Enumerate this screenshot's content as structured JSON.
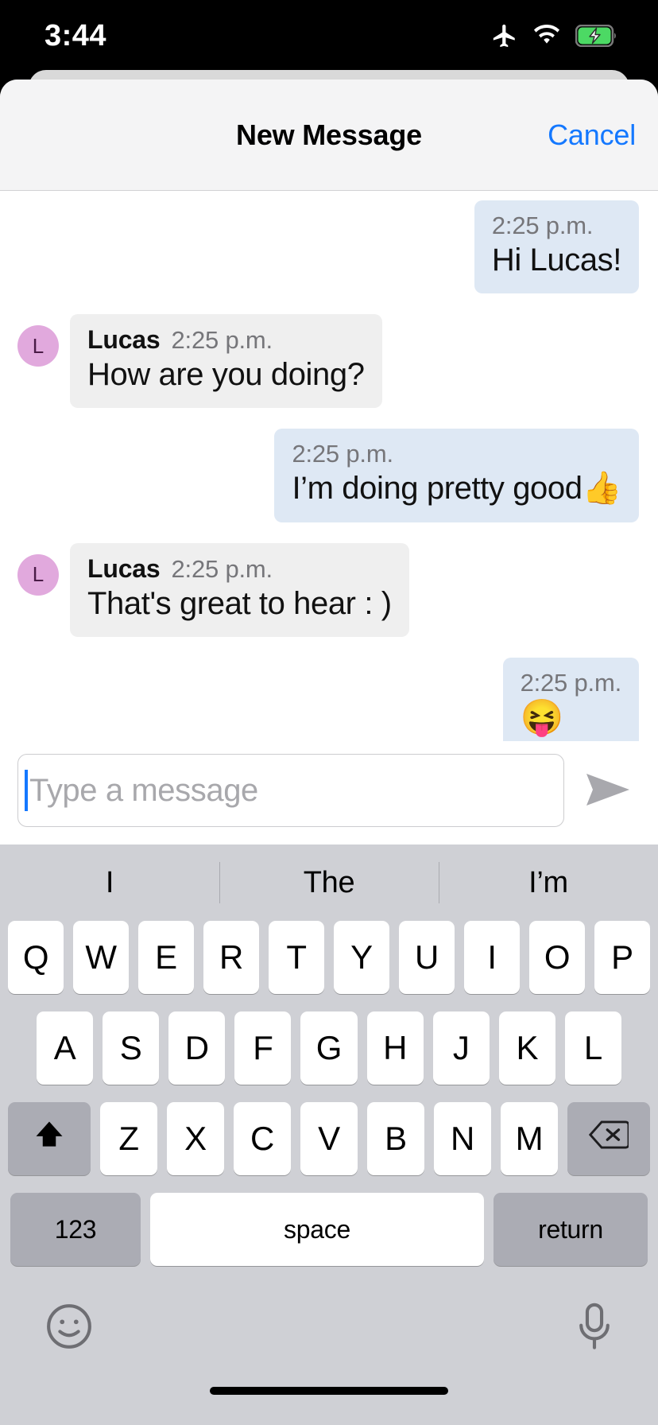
{
  "status_bar": {
    "time": "3:44",
    "icons": [
      "airplane-mode-icon",
      "wifi-icon",
      "battery-charging-icon"
    ],
    "battery_color": "#4cd964"
  },
  "sheet": {
    "title": "New Message",
    "cancel_label": "Cancel",
    "header_bg": "#f4f4f5",
    "accent_color": "#1478ff"
  },
  "conversation": {
    "messages": [
      {
        "direction": "outgoing",
        "sender": "",
        "time": "2:25 p.m.",
        "text": "Hi Lucas!",
        "emoji_only": false
      },
      {
        "direction": "incoming",
        "sender": "Lucas",
        "avatar_initial": "L",
        "time": "2:25 p.m.",
        "text": "How are you doing?",
        "emoji_only": false
      },
      {
        "direction": "outgoing",
        "sender": "",
        "time": "2:25 p.m.",
        "text": "I’m doing pretty good👍",
        "emoji_only": false
      },
      {
        "direction": "incoming",
        "sender": "Lucas",
        "avatar_initial": "L",
        "time": "2:25 p.m.",
        "text": "That's great to hear : )",
        "emoji_only": false
      },
      {
        "direction": "outgoing",
        "sender": "",
        "time": "2:25 p.m.",
        "text": "😝",
        "emoji_only": true
      }
    ],
    "outgoing_bubble_color": "#dee8f4",
    "incoming_bubble_color": "#efefef",
    "avatar_color": "#e1a9dd"
  },
  "composer": {
    "placeholder": "Type a message",
    "value": "",
    "send_icon": "send-arrow-icon"
  },
  "keyboard": {
    "suggestions": [
      "I",
      "The",
      "I’m"
    ],
    "row1": [
      "Q",
      "W",
      "E",
      "R",
      "T",
      "Y",
      "U",
      "I",
      "O",
      "P"
    ],
    "row2": [
      "A",
      "S",
      "D",
      "F",
      "G",
      "H",
      "J",
      "K",
      "L"
    ],
    "row3": [
      "Z",
      "X",
      "C",
      "V",
      "B",
      "N",
      "M"
    ],
    "shift_label": "shift-icon",
    "backspace_label": "backspace-icon",
    "numbers_label": "123",
    "space_label": "space",
    "return_label": "return",
    "emoji_label": "emoji-icon",
    "dictation_label": "microphone-icon",
    "bg_color": "#cfd0d5",
    "key_color": "#ffffff",
    "mod_key_color": "#abacb4"
  }
}
